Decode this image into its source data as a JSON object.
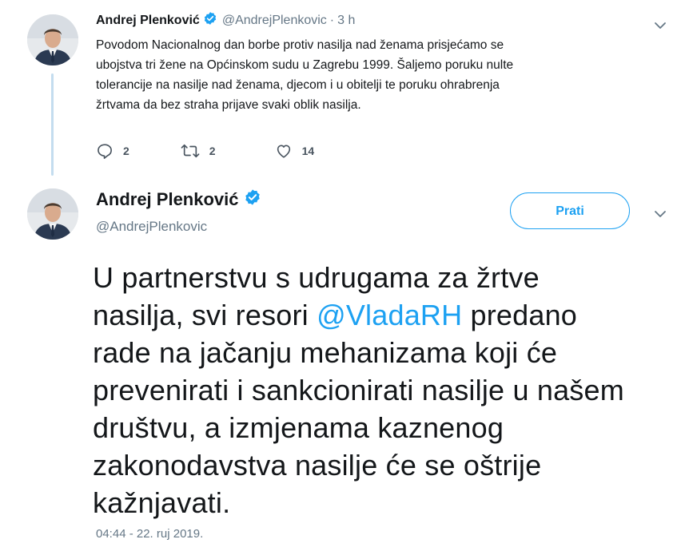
{
  "tweet1": {
    "name": "Andrej Plenković",
    "handle": "@AndrejPlenkovic",
    "separator": "·",
    "time": "3 h",
    "text_lines": [
      "Povodom Nacionalnog dan borbe protiv nasilja nad ženama prisjećamo se",
      "ubojstva tri žene na Općinskom sudu u Zagrebu 1999. Šaljemo poruku nulte",
      "tolerancije na nasilje nad ženama, djecom i u obitelji te poruku ohrabrenja",
      "žrtvama da bez straha prijave svaki oblik nasilja."
    ],
    "replies": "2",
    "retweets": "2",
    "likes": "14",
    "icons": [
      "verified-badge-icon",
      "chevron-down-icon",
      "reply-icon",
      "retweet-icon",
      "heart-icon"
    ]
  },
  "tweet2": {
    "name": "Andrej Plenković",
    "handle": "@AndrejPlenkovic",
    "follow_label": "Prati",
    "text": {
      "line1": "U partnerstvu s udrugama za žrtve",
      "line2_pre": "nasilja, svi resori ",
      "line2_mention": "@VladaRH",
      "line2_post": " predano",
      "line3": "rade na jačanju mehanizama koji će",
      "line4": "prevenirati i sankcionirati nasilje u našem",
      "line5": "društvu, a izmjenama kaznenog",
      "line6": "zakonodavstva nasilje će se oštrije",
      "line7": "kažnjavati."
    },
    "date": "04:44 - 22. ruj 2019.",
    "icons": [
      "verified-badge-icon",
      "chevron-down-icon"
    ]
  },
  "colors": {
    "accent": "#1da1f2",
    "muted": "#657786",
    "text": "#14171a",
    "thread_line": "#c4ddef"
  }
}
